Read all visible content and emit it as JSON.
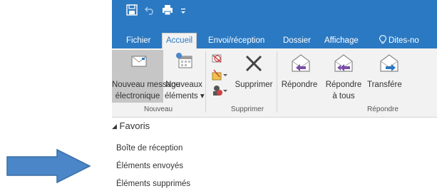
{
  "ribbon_tabs": {
    "file": "Fichier",
    "home": "Accueil",
    "send_receive": "Envoi/réception",
    "folder": "Dossier",
    "view": "Affichage",
    "tell_me": "Dites-no"
  },
  "groups": {
    "new": {
      "label": "Nouveau",
      "new_email_line1": "Nouveau message",
      "new_email_line2": "électronique",
      "new_items_line1": "Nouveaux",
      "new_items_line2": "éléments"
    },
    "delete": {
      "label": "Supprimer",
      "delete_button": "Supprimer"
    },
    "respond": {
      "label": "Répondre",
      "reply": "Répondre",
      "reply_all_line1": "Répondre",
      "reply_all_line2": "à tous",
      "forward": "Transfére"
    }
  },
  "folder_pane": {
    "favorites_label": "Favoris",
    "items": [
      "Boîte de réception",
      "Éléments envoyés",
      "Éléments supprimés"
    ]
  },
  "icons": {
    "arrow": "right-arrow-icon",
    "save": "save-icon",
    "undo": "undo-icon",
    "print": "print-icon",
    "qat_menu": "dropdown-icon",
    "tell_me": "lightbulb-icon",
    "new_email": "envelope-icon",
    "new_items": "calendar-icon",
    "ignore": "ignore-icon",
    "cleanup": "cleanup-icon",
    "junk": "junk-icon",
    "delete": "delete-x-icon",
    "reply": "reply-icon",
    "reply_all": "reply-all-icon",
    "forward": "forward-icon"
  },
  "colors": {
    "title_bar": "#2b79c2",
    "ribbon": "#f2f2f2",
    "selected_button": "#c6c6c6",
    "arrow": "#4a86c8",
    "reply_accent": "#7b4fa8"
  }
}
